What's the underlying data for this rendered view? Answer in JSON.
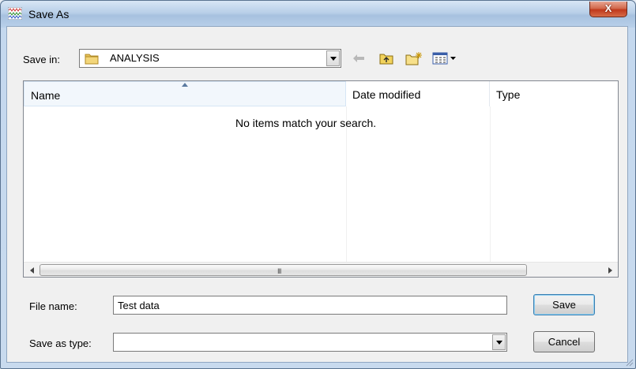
{
  "window": {
    "title": "Save As",
    "close_glyph": "X"
  },
  "toolbar": {
    "save_in_label": "Save in:",
    "save_in_value": "ANALYSIS",
    "icons": [
      "back-arrow-icon",
      "up-folder-icon",
      "new-folder-icon",
      "view-menu-icon"
    ]
  },
  "list": {
    "columns": [
      "Name",
      "Date modified",
      "Type"
    ],
    "empty_message": "No items match your search.",
    "scroll_grip": "III"
  },
  "form": {
    "file_name_label": "File name:",
    "file_name_value": "Test data",
    "save_as_type_label": "Save as type:",
    "save_as_type_value": ""
  },
  "buttons": {
    "save": "Save",
    "cancel": "Cancel"
  },
  "colors": {
    "accent": "#3c7fb1",
    "close": "#c0391c",
    "frame": "#a9c4e2"
  }
}
